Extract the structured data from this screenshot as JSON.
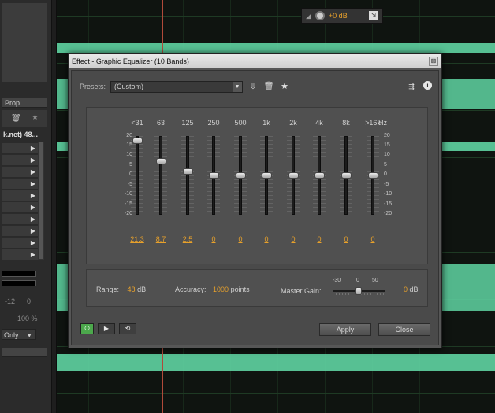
{
  "dialog": {
    "title": "Effect - Graphic Equalizer (10 Bands)",
    "close_glyph": "⊠",
    "presets_label": "Presets:",
    "presets_value": "(Custom)",
    "apply_label": "Apply",
    "close_label": "Close"
  },
  "bands": [
    {
      "label": "<31",
      "value": "21.3",
      "gain_db": 21.3
    },
    {
      "label": "63",
      "value": "8.7",
      "gain_db": 8.7
    },
    {
      "label": "125",
      "value": "2.5",
      "gain_db": 2.5
    },
    {
      "label": "250",
      "value": "0",
      "gain_db": 0
    },
    {
      "label": "500",
      "value": "0",
      "gain_db": 0
    },
    {
      "label": "1k",
      "value": "0",
      "gain_db": 0
    },
    {
      "label": "2k",
      "value": "0",
      "gain_db": 0
    },
    {
      "label": "4k",
      "value": "0",
      "gain_db": 0
    },
    {
      "label": "8k",
      "value": "0",
      "gain_db": 0
    },
    {
      "label": ">16k",
      "value": "0",
      "gain_db": 0
    }
  ],
  "hz_unit": "Hz",
  "scale_ticks": [
    "20",
    "15",
    "10",
    "5",
    "0",
    "-5",
    "-10",
    "-15",
    "-20"
  ],
  "range": {
    "label": "Range:",
    "value": "48",
    "unit": "dB"
  },
  "accuracy": {
    "label": "Accuracy:",
    "value": "1000",
    "unit": "points"
  },
  "master_gain": {
    "label": "Master Gain:",
    "scale": [
      "-30",
      "0",
      "50"
    ],
    "value_text": "0",
    "unit": "dB",
    "level": 0.5
  },
  "volume_hud": {
    "value": "+0 dB"
  },
  "host": {
    "panel_tab": "Prop",
    "file_text": "k.net) 48...",
    "meter_scale": [
      "-12",
      "0"
    ],
    "zoom_text": "100 %",
    "filter_text": "Only"
  },
  "colors": {
    "accent_orange": "#e8a12b",
    "waveform_green": "#5fd3a2",
    "power_green": "#4ca84c"
  }
}
